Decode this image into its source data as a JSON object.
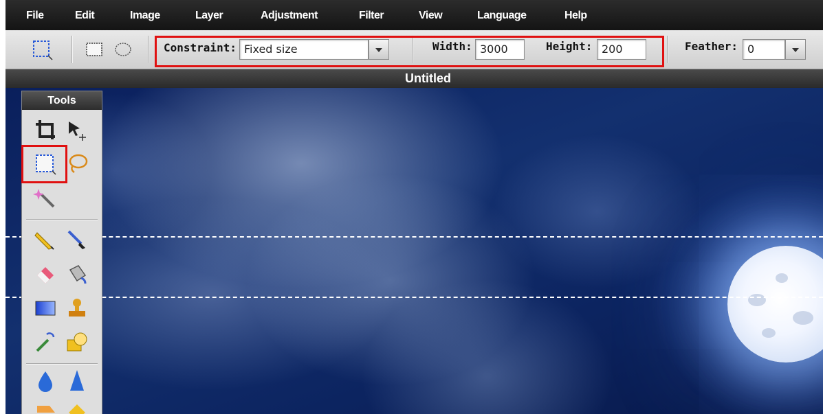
{
  "menu": {
    "items": [
      "File",
      "Edit",
      "Image",
      "Layer",
      "Adjustment",
      "Filter",
      "View",
      "Language",
      "Help"
    ]
  },
  "options": {
    "constraint_label": "Constraint:",
    "constraint_value": "Fixed size",
    "width_label": "Width:",
    "width_value": "3000",
    "height_label": "Height:",
    "height_value": "200",
    "feather_label": "Feather:",
    "feather_value": "0"
  },
  "document": {
    "title": "Untitled"
  },
  "tools": {
    "title": "Tools",
    "icons": [
      "crop-icon",
      "move-icon",
      "rect-marquee-icon",
      "lasso-icon",
      "magic-wand-icon",
      "pencil-icon",
      "brush-icon",
      "eraser-icon",
      "paint-bucket-icon",
      "gradient-icon",
      "clone-stamp-icon",
      "color-replace-icon",
      "shape-icon",
      "blur-icon",
      "sharpen-icon"
    ]
  },
  "colors": {
    "highlight": "#e01010",
    "menu_bg": "#1f1f1f",
    "canvas_sky": "#13306f"
  }
}
